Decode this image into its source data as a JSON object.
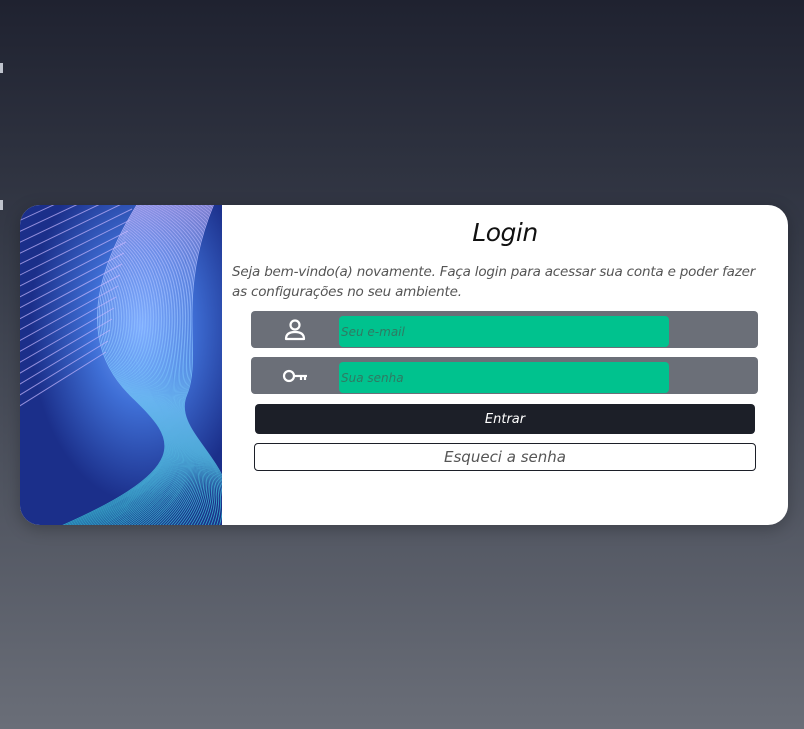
{
  "login": {
    "title": "Login",
    "subtitle": "Seja bem-vindo(a) novamente. Faça login para acessar sua conta e poder fazer as configurações no seu ambiente.",
    "email": {
      "placeholder": "Seu e-mail",
      "value": "",
      "icon": "user-icon"
    },
    "password": {
      "placeholder": "Sua senha",
      "value": "",
      "icon": "key-icon"
    },
    "submit_label": "Entrar",
    "forgot_label": "Esqueci a senha"
  },
  "colors": {
    "input_bg": "#00c28e",
    "field_bg": "#6b6f78",
    "primary_button": "#1c1f28",
    "card_bg": "#ffffff"
  }
}
